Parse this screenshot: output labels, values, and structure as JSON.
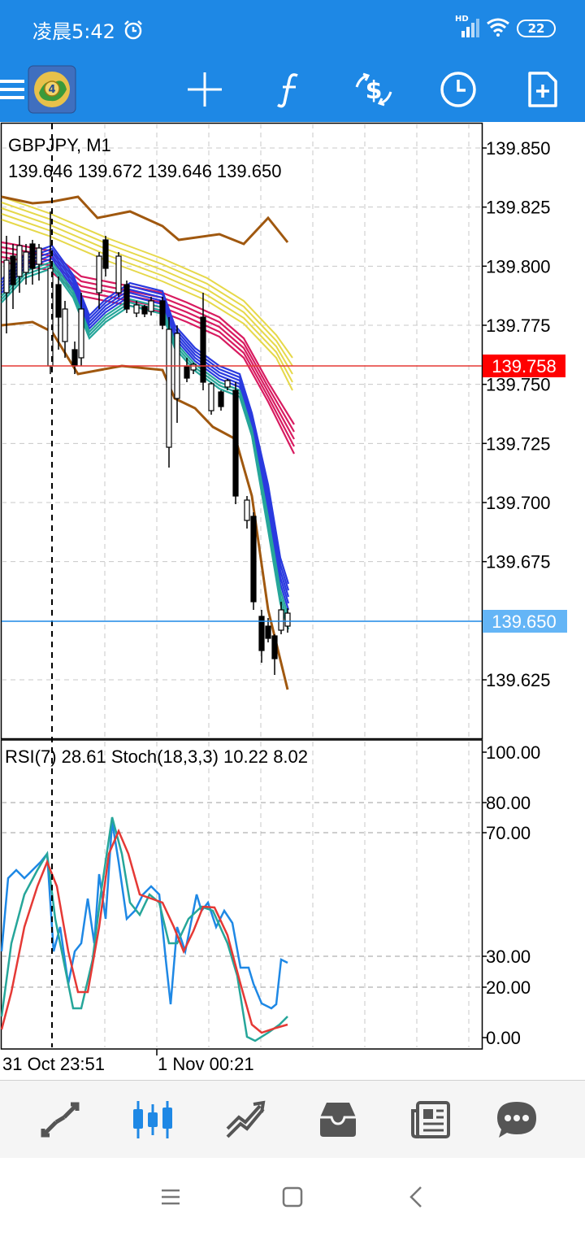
{
  "status_bar": {
    "time": "凌晨5:42",
    "network_label": "HD",
    "battery": "22",
    "icons": [
      "alarm-icon",
      "signal-icon",
      "wifi-icon",
      "battery-icon"
    ]
  },
  "toolbar": {
    "icons": [
      "menu-icon",
      "metatrader-logo",
      "crosshair-icon",
      "function-icon",
      "symbol-icon",
      "clock-icon",
      "new-document-icon"
    ]
  },
  "chart": {
    "symbol": "GBPJPY, M1",
    "ohlc": "139.646 139.672 139.646 139.650",
    "price_ticks": [
      "139.850",
      "139.825",
      "139.800",
      "139.775",
      "139.750",
      "139.725",
      "139.700",
      "139.675",
      "139.625"
    ],
    "red_line_label": "139.758",
    "blue_line_label": "139.650",
    "indicator_label": "RSI(7) 28.61 Stoch(18,3,3) 10.22 8.02",
    "indicator_ticks": [
      "100.00",
      "80.00",
      "70.00",
      "30.00",
      "20.00",
      "0.00"
    ],
    "time_labels": [
      "31 Oct 23:51",
      "1 Nov 00:21"
    ],
    "colors": {
      "red_line": "#e53935",
      "blue_line": "#1e88e5",
      "bid_label_bg": "#64b5f6",
      "ask_label_bg": "#ff0000",
      "yellow_ma": "#e6d84a",
      "magenta_ma": "#d81b60",
      "blue_ma": "#2a3adf",
      "green_ma": "#26a69a",
      "brown_band": "#a0580f",
      "rsi": "#1e88e5",
      "stoch_main": "#26a69a",
      "stoch_signal": "#e53935"
    }
  },
  "bottom_nav": {
    "items": [
      "quotes-icon",
      "chart-icon",
      "trade-icon",
      "history-icon",
      "news-icon",
      "chat-icon"
    ]
  },
  "system_nav": {
    "items": [
      "menu-button",
      "home-button",
      "back-button"
    ]
  }
}
